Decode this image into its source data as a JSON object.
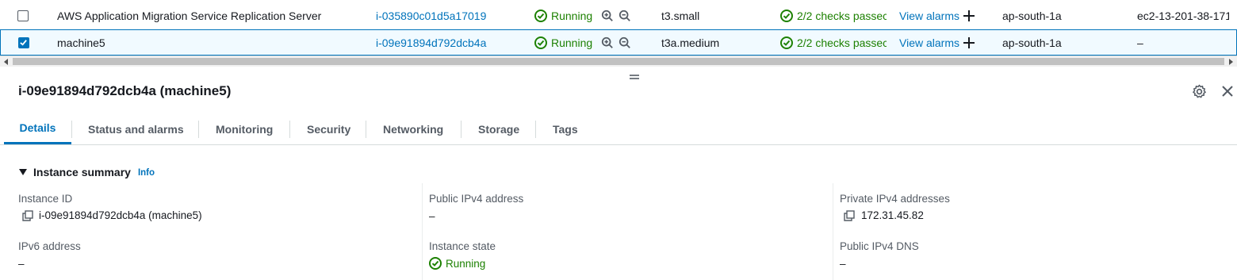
{
  "table": {
    "rows": [
      {
        "name": "AWS Application Migration Service Replication Server",
        "instance_id": "i-035890c01d5a17019",
        "state": "Running",
        "type": "t3.small",
        "checks": "2/2 checks passec",
        "alarms": "View alarms",
        "az": "ap-south-1a",
        "dns": "ec2-13-201-38-171",
        "selected": false
      },
      {
        "name": "machine5",
        "instance_id": "i-09e91894d792dcb4a",
        "state": "Running",
        "type": "t3a.medium",
        "checks": "2/2 checks passec",
        "alarms": "View alarms",
        "az": "ap-south-1a",
        "dns": "–",
        "selected": true
      }
    ]
  },
  "panel": {
    "title": "i-09e91894d792dcb4a (machine5)",
    "tabs": [
      "Details",
      "Status and alarms",
      "Monitoring",
      "Security",
      "Networking",
      "Storage",
      "Tags"
    ],
    "active_tab": "Details",
    "section_title": "Instance summary",
    "info_label": "Info",
    "fields": {
      "instance_id_label": "Instance ID",
      "instance_id_value": "i-09e91894d792dcb4a (machine5)",
      "public_ipv4_label": "Public IPv4 address",
      "public_ipv4_value": "–",
      "private_ipv4_label": "Private IPv4 addresses",
      "private_ipv4_value": "172.31.45.82",
      "ipv6_label": "IPv6 address",
      "ipv6_value": "–",
      "instance_state_label": "Instance state",
      "instance_state_value": "Running",
      "public_dns_label": "Public IPv4 DNS",
      "public_dns_value": "–"
    }
  },
  "colors": {
    "link": "#0073bb",
    "success": "#1d8102",
    "selected_row_bg": "#f1faff"
  }
}
